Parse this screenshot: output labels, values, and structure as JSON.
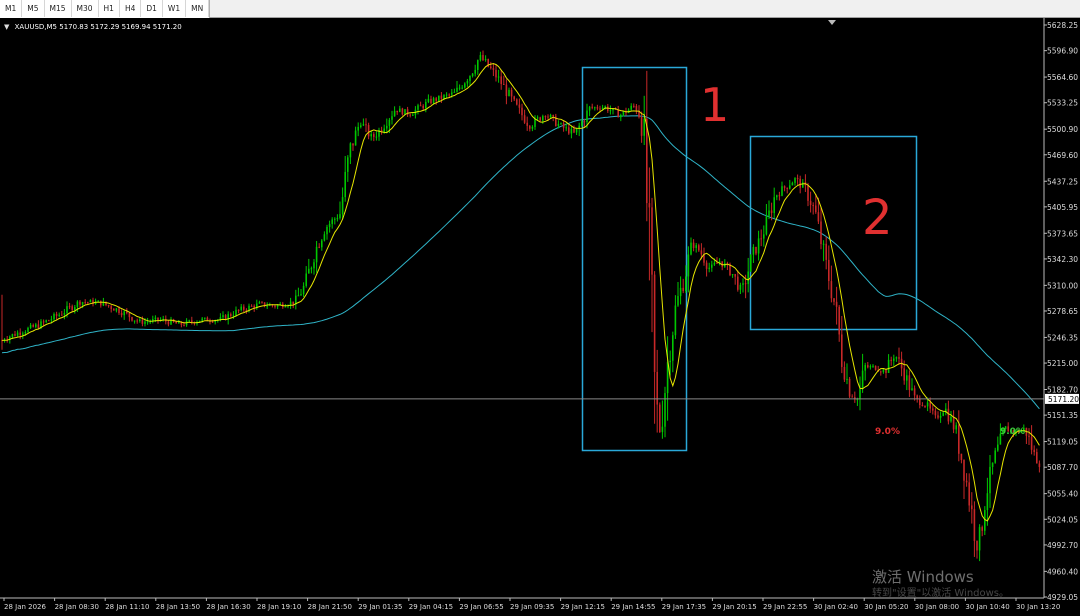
{
  "toolbar": {
    "timeframes": [
      "M1",
      "M5",
      "M15",
      "M30",
      "H1",
      "H4",
      "D1",
      "W1",
      "MN"
    ]
  },
  "chart": {
    "symbol": "XAUUSD,M5",
    "ohlc": "5170.83 5172.29 5169.94 5171.20",
    "current_price_label": "5171.20",
    "annotations": {
      "box1_label": "1",
      "box2_label": "2",
      "pct_label_1": "9.0%",
      "pct_label_2": "9.0%"
    },
    "watermark": "激活 Windows",
    "watermark_sub": "转到\"设置\"以激活 Windows。"
  },
  "colors": {
    "background": "#000000",
    "bull_candle": "#00c800",
    "bear_candle": "#c82828",
    "ma_fast": "#e6e600",
    "ma_slow": "#2fb4c8",
    "annotation_box": "#2aa8d8",
    "annotation_text": "#e03030",
    "price_line": "#888888"
  },
  "chart_data": {
    "type": "candlestick",
    "symbol": "XAUUSD",
    "timeframe": "M5",
    "y_axis_ticks": [
      5628.25,
      5596.9,
      5564.6,
      5533.25,
      5500.9,
      5469.6,
      5437.25,
      5405.95,
      5373.65,
      5342.3,
      5310.0,
      5278.65,
      5246.35,
      5215.0,
      5182.7,
      5151.35,
      5119.05,
      5087.7,
      5055.4,
      5024.05,
      4992.7,
      4960.4,
      4929.05
    ],
    "ylim": [
      4929.05,
      5628.25
    ],
    "x_axis_ticks": [
      "28 Jan 2026",
      "28 Jan 08:30",
      "28 Jan 11:10",
      "28 Jan 13:50",
      "28 Jan 16:30",
      "28 Jan 19:10",
      "28 Jan 21:50",
      "29 Jan 01:35",
      "29 Jan 04:15",
      "29 Jan 06:55",
      "29 Jan 09:35",
      "29 Jan 12:15",
      "29 Jan 14:55",
      "29 Jan 17:35",
      "29 Jan 20:15",
      "29 Jan 22:55",
      "30 Jan 02:40",
      "30 Jan 05:20",
      "30 Jan 08:00",
      "30 Jan 10:40",
      "30 Jan 13:20"
    ],
    "current_price": 5171.2,
    "price_path_approx": [
      [
        0,
        5243
      ],
      [
        20,
        5253
      ],
      [
        40,
        5262
      ],
      [
        60,
        5275
      ],
      [
        80,
        5290
      ],
      [
        100,
        5289
      ],
      [
        120,
        5279
      ],
      [
        140,
        5265
      ],
      [
        160,
        5268
      ],
      [
        180,
        5262
      ],
      [
        200,
        5268
      ],
      [
        220,
        5268
      ],
      [
        240,
        5280
      ],
      [
        260,
        5287
      ],
      [
        275,
        5285
      ],
      [
        295,
        5290
      ],
      [
        305,
        5310
      ],
      [
        315,
        5352
      ],
      [
        325,
        5380
      ],
      [
        340,
        5398
      ],
      [
        350,
        5475
      ],
      [
        360,
        5510
      ],
      [
        372,
        5490
      ],
      [
        380,
        5500
      ],
      [
        395,
        5525
      ],
      [
        410,
        5520
      ],
      [
        430,
        5535
      ],
      [
        455,
        5545
      ],
      [
        470,
        5568
      ],
      [
        480,
        5590
      ],
      [
        490,
        5575
      ],
      [
        500,
        5560
      ],
      [
        515,
        5530
      ],
      [
        530,
        5505
      ],
      [
        545,
        5520
      ],
      [
        560,
        5505
      ],
      [
        575,
        5495
      ],
      [
        590,
        5527
      ],
      [
        605,
        5528
      ],
      [
        620,
        5518
      ],
      [
        635,
        5530
      ],
      [
        642,
        5512
      ],
      [
        645,
        5460
      ],
      [
        650,
        5330
      ],
      [
        655,
        5175
      ],
      [
        660,
        5130
      ],
      [
        668,
        5220
      ],
      [
        676,
        5285
      ],
      [
        684,
        5318
      ],
      [
        692,
        5360
      ],
      [
        700,
        5352
      ],
      [
        710,
        5330
      ],
      [
        720,
        5340
      ],
      [
        732,
        5325
      ],
      [
        742,
        5302
      ],
      [
        752,
        5345
      ],
      [
        765,
        5380
      ],
      [
        775,
        5420
      ],
      [
        785,
        5430
      ],
      [
        795,
        5440
      ],
      [
        805,
        5428
      ],
      [
        815,
        5400
      ],
      [
        825,
        5340
      ],
      [
        835,
        5285
      ],
      [
        842,
        5220
      ],
      [
        850,
        5180
      ],
      [
        858,
        5170
      ],
      [
        865,
        5210
      ],
      [
        875,
        5210
      ],
      [
        885,
        5205
      ],
      [
        895,
        5226
      ],
      [
        905,
        5200
      ],
      [
        915,
        5170
      ],
      [
        925,
        5165
      ],
      [
        935,
        5148
      ],
      [
        945,
        5160
      ],
      [
        955,
        5135
      ],
      [
        965,
        5080
      ],
      [
        972,
        5030
      ],
      [
        978,
        4985
      ],
      [
        985,
        5050
      ],
      [
        995,
        5100
      ],
      [
        1005,
        5135
      ],
      [
        1015,
        5130
      ],
      [
        1025,
        5135
      ],
      [
        1035,
        5100
      ],
      [
        1044,
        5087
      ]
    ],
    "series": [
      {
        "name": "",
        "kind": "moving-average-fast",
        "color": "#e6e600"
      },
      {
        "name": "",
        "kind": "moving-average-slow",
        "color": "#2fb4c8"
      }
    ]
  }
}
